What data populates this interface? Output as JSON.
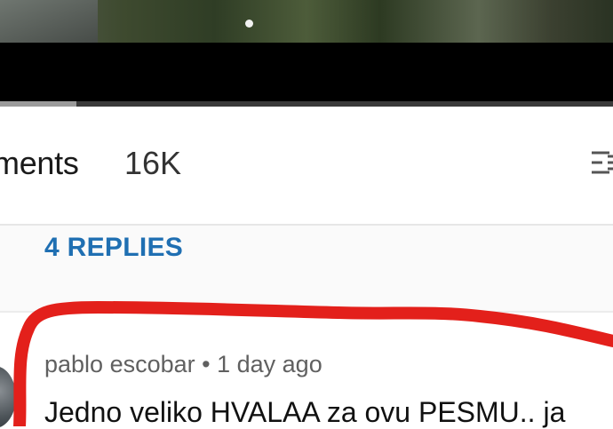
{
  "video": {
    "progress_fraction": 0.125
  },
  "comments_header": {
    "title": "ments",
    "count": "16K",
    "sort_icon": "sort-icon"
  },
  "replies": {
    "label": "4 REPLIES"
  },
  "comment": {
    "author": "pablo escobar",
    "separator": "•",
    "time": "1 day ago",
    "text": "Jedno veliko HVALAA za ovu PESMU.. ja"
  },
  "colors": {
    "reply_link": "#1f6fb2",
    "annotation": "#e3201b"
  }
}
